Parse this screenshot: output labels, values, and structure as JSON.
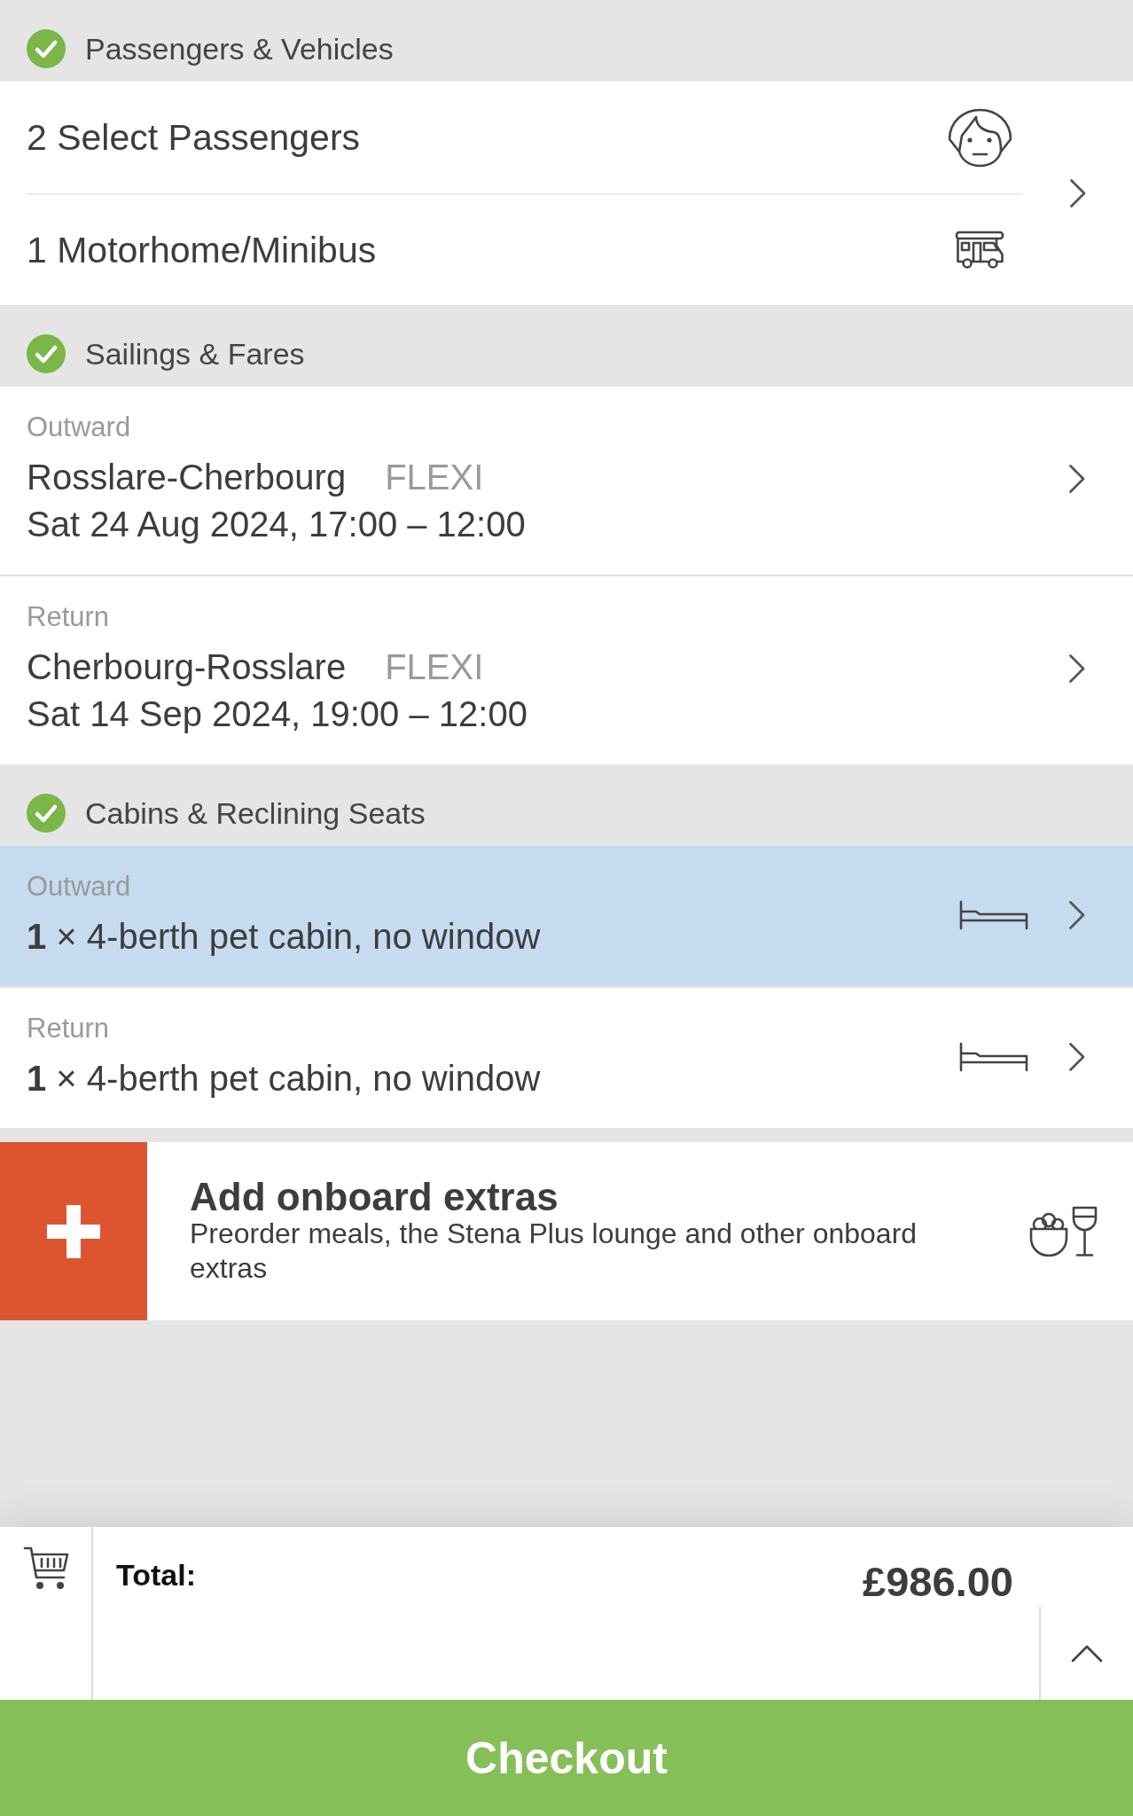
{
  "passengers_vehicles": {
    "title": "Passengers & Vehicles",
    "completed": true,
    "items": [
      {
        "kind": "passenger",
        "text": "2 Select Passengers"
      },
      {
        "kind": "vehicle",
        "text": "1 Motorhome/Minibus"
      }
    ]
  },
  "sailings_fares": {
    "title": "Sailings & Fares",
    "completed": true,
    "legs": [
      {
        "label": "Outward",
        "route": "Rosslare-Cherbourg",
        "fare": "FLEXI",
        "times": "Sat 24 Aug 2024, 17:00 – 12:00"
      },
      {
        "label": "Return",
        "route": "Cherbourg-Rosslare",
        "fare": "FLEXI",
        "times": "Sat 14 Sep 2024, 19:00 – 12:00"
      }
    ]
  },
  "cabins_seats": {
    "title": "Cabins & Reclining Seats",
    "completed": true,
    "legs": [
      {
        "label": "Outward",
        "cabin": "**1** × 4-berth pet cabin, no window",
        "selected": true
      },
      {
        "label": "Return",
        "cabin": "**1** × 4-berth pet cabin, no window",
        "selected": false
      }
    ]
  },
  "extras": {
    "title": "Add onboard extras",
    "description": "Preorder meals, the Stena Plus lounge and other onboard extras"
  },
  "basket": {
    "total_label": "Total:",
    "total": "£986.00",
    "expanded": false
  },
  "checkout": {
    "label": "Checkout"
  }
}
